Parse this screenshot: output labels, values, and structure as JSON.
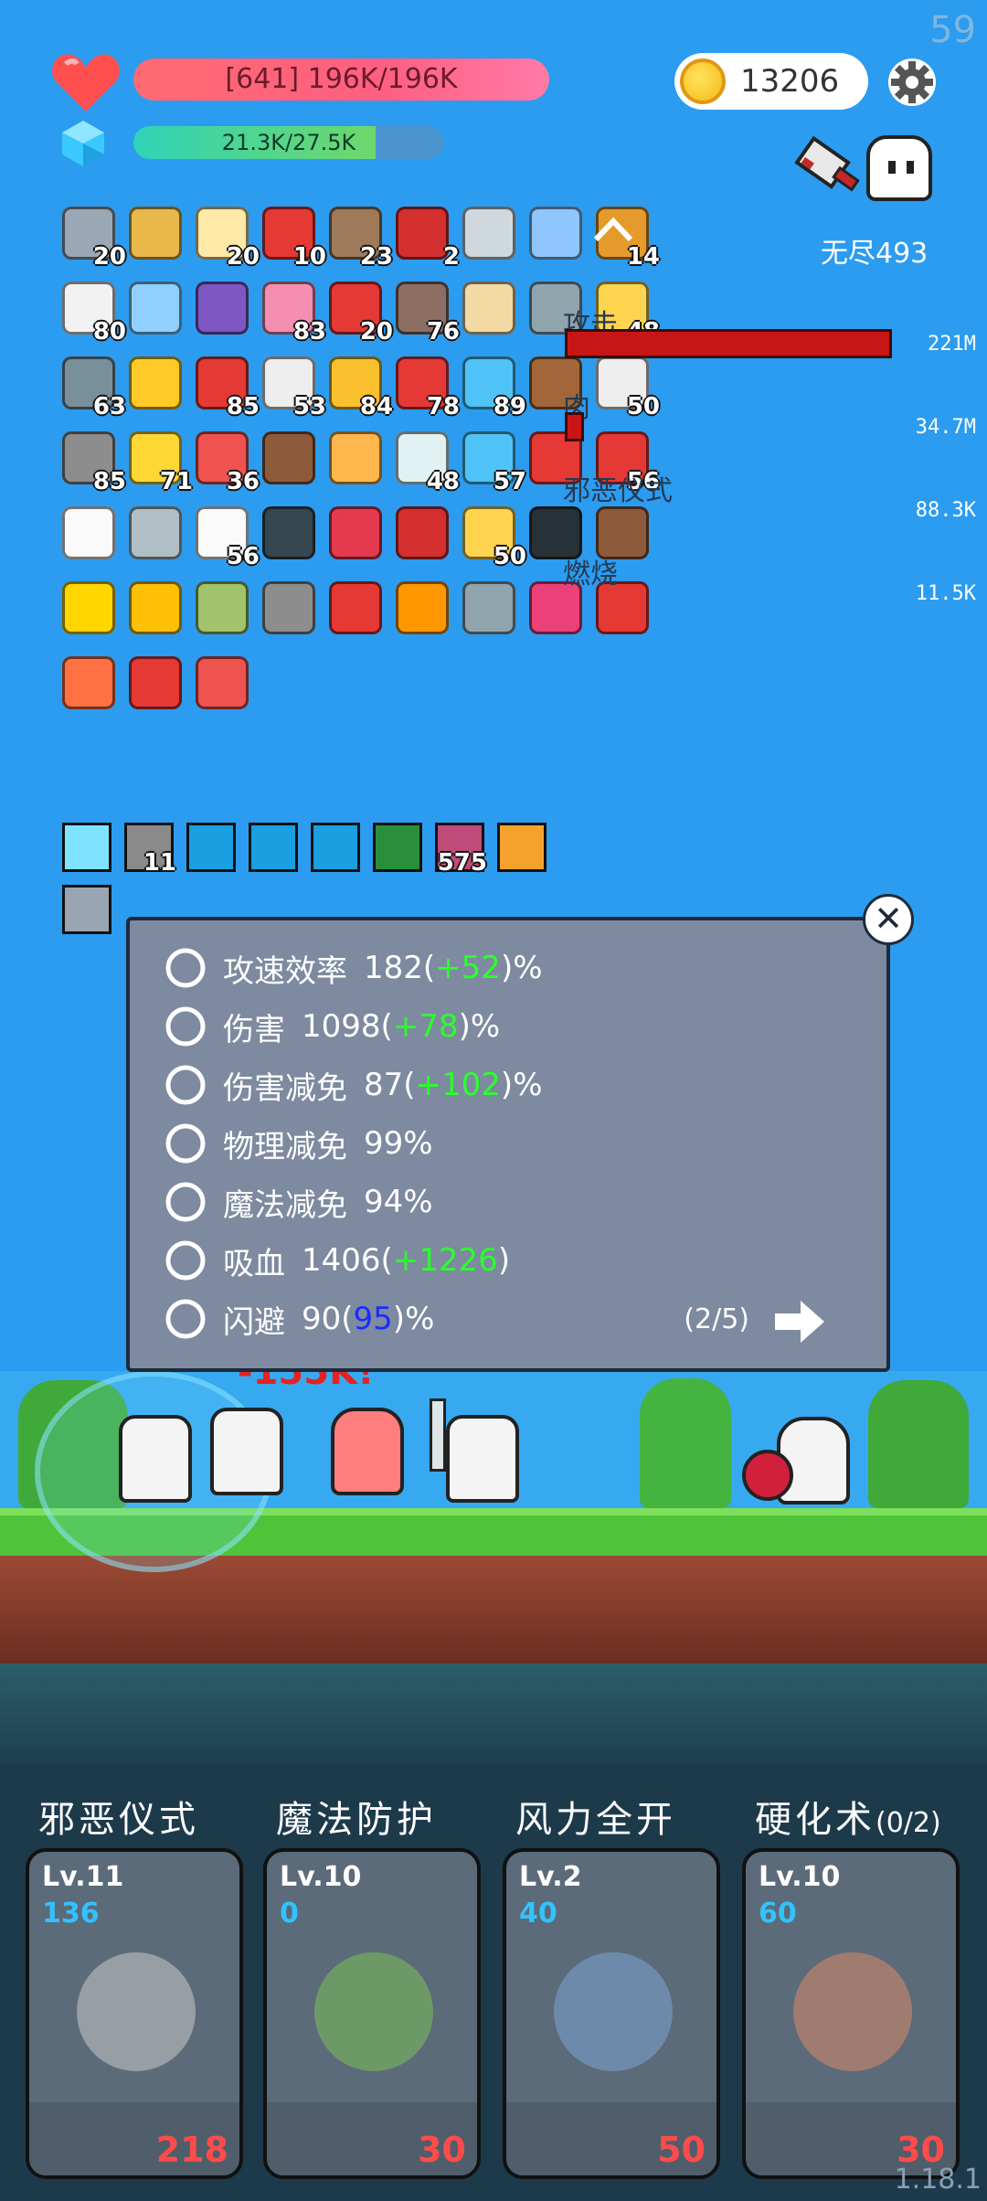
{
  "fps": "59",
  "hud": {
    "hp_text": "[641] 196K/196K",
    "mp_text": "21.3K/27.5K",
    "mp_fraction": 0.78,
    "coins": "13206",
    "mode": "无尽493"
  },
  "inventory": {
    "items": [
      {
        "icon": "sword-icon",
        "count": "20",
        "color": "#9aa7b4"
      },
      {
        "icon": "scroll-icon",
        "count": "",
        "color": "#e8b84a"
      },
      {
        "icon": "flower-icon",
        "count": "20",
        "color": "#ffe9a6"
      },
      {
        "icon": "apple-icon",
        "count": "10",
        "color": "#e53935"
      },
      {
        "icon": "target-icon",
        "count": "23",
        "color": "#9e7a5a"
      },
      {
        "icon": "magnet-icon",
        "count": "2",
        "color": "#d32f2f"
      },
      {
        "icon": "blade-icon",
        "count": "",
        "color": "#cfd8dc"
      },
      {
        "icon": "card-icon",
        "count": "",
        "color": "#8fc6ff"
      },
      {
        "icon": "book-icon",
        "count": "14",
        "color": "#e59b2b"
      },
      {
        "icon": "envelope-icon",
        "count": "80",
        "color": "#f2f2f2"
      },
      {
        "icon": "frame-icon",
        "count": "",
        "color": "#8fd0ff"
      },
      {
        "icon": "chest-icon",
        "count": "",
        "color": "#7e57c2"
      },
      {
        "icon": "icecream-icon",
        "count": "83",
        "color": "#f48fb1"
      },
      {
        "icon": "watermelon-icon",
        "count": "20",
        "color": "#e53935"
      },
      {
        "icon": "coconut-icon",
        "count": "76",
        "color": "#8d6e63"
      },
      {
        "icon": "map-icon",
        "count": "",
        "color": "#f3d9a4"
      },
      {
        "icon": "helmet-icon",
        "count": "",
        "color": "#90a4ae"
      },
      {
        "icon": "note-icon",
        "count": "48",
        "color": "#ffd54f"
      },
      {
        "icon": "mace-icon",
        "count": "63",
        "color": "#78909c"
      },
      {
        "icon": "ring-icon",
        "count": "",
        "color": "#ffca28"
      },
      {
        "icon": "redcard-icon",
        "count": "85",
        "color": "#e53935"
      },
      {
        "icon": "dice-icon",
        "count": "53",
        "color": "#eeeeee"
      },
      {
        "icon": "pineapple-icon",
        "count": "84",
        "color": "#fbc02d"
      },
      {
        "icon": "strawberry-icon",
        "count": "78",
        "color": "#e53935"
      },
      {
        "icon": "feather-icon",
        "count": "89",
        "color": "#4fc3f7"
      },
      {
        "icon": "drumstick-icon",
        "count": "",
        "color": "#a1663a"
      },
      {
        "icon": "cards-icon",
        "count": "50",
        "color": "#eeeeee"
      },
      {
        "icon": "tombstone-icon",
        "count": "85",
        "color": "#8d8d8d"
      },
      {
        "icon": "battery-icon",
        "count": "71",
        "color": "#fdd835"
      },
      {
        "icon": "pill-icon",
        "count": "36",
        "color": "#ef5350"
      },
      {
        "icon": "mushroom-icon",
        "count": "",
        "color": "#8d5a3a"
      },
      {
        "icon": "briefcase-icon",
        "count": "",
        "color": "#ffb74d"
      },
      {
        "icon": "bubbles-icon",
        "count": "48",
        "color": "#e0f2f1"
      },
      {
        "icon": "potion-icon",
        "count": "57",
        "color": "#4fc3f7"
      },
      {
        "icon": "hook-icon",
        "count": "",
        "color": "#e53935"
      },
      {
        "icon": "sock-icon",
        "count": "56",
        "color": "#e53935"
      },
      {
        "icon": "checklist-icon",
        "count": "",
        "color": "#fafafa"
      },
      {
        "icon": "hammer-icon",
        "count": "",
        "color": "#b0bec5"
      },
      {
        "icon": "ghost-icon",
        "count": "56",
        "color": "#fafafa"
      },
      {
        "icon": "skullbook-icon",
        "count": "",
        "color": "#37474f"
      },
      {
        "icon": "gem-icon",
        "count": "",
        "color": "#e53950"
      },
      {
        "icon": "shield-icon",
        "count": "",
        "color": "#d32f2f"
      },
      {
        "icon": "cheese-icon",
        "count": "50",
        "color": "#ffd54f"
      },
      {
        "icon": "cauldron-icon",
        "count": "",
        "color": "#263238"
      },
      {
        "icon": "drink-icon",
        "count": "",
        "color": "#8d5a3a"
      },
      {
        "icon": "sun-icon",
        "count": "",
        "color": "#ffd600"
      },
      {
        "icon": "wand-icon",
        "count": "",
        "color": "#ffc107"
      },
      {
        "icon": "crossbow-icon",
        "count": "",
        "color": "#a0c36b"
      },
      {
        "icon": "meteor-icon",
        "count": "",
        "color": "#8d8d8d"
      },
      {
        "icon": "shoe-icon",
        "count": "",
        "color": "#e53935"
      },
      {
        "icon": "crown-icon",
        "count": "",
        "color": "#ff9800"
      },
      {
        "icon": "axe-icon",
        "count": "",
        "color": "#90a4ae"
      },
      {
        "icon": "flame-icon",
        "count": "",
        "color": "#ec407a"
      },
      {
        "icon": "thermometer-icon",
        "count": "",
        "color": "#e53935"
      },
      {
        "icon": "gift-icon",
        "count": "",
        "color": "#ff7043"
      },
      {
        "icon": "heat-icon",
        "count": "",
        "color": "#e53935"
      },
      {
        "icon": "heart-icon",
        "count": "",
        "color": "#ef5350"
      }
    ]
  },
  "damage_stats": [
    {
      "label": "攻击",
      "value": "221M",
      "bar_fraction": 1.0
    },
    {
      "label": "肉",
      "value": "34.7M",
      "bar_fraction": 0.06
    },
    {
      "label": "邪恶仪式",
      "value": "88.3K",
      "bar_fraction": 0
    },
    {
      "label": "燃烧",
      "value": "11.5K",
      "bar_fraction": 0
    }
  ],
  "buffs": [
    {
      "icon": "light-buff-icon",
      "count": "",
      "color": "#7fe3ff"
    },
    {
      "icon": "armor-buff-icon",
      "count": "11",
      "color": "#8a8a8a"
    },
    {
      "icon": "vortex-buff-icon",
      "count": "",
      "color": "#1a9fe0"
    },
    {
      "icon": "vortex-buff-icon",
      "count": "",
      "color": "#1a9fe0"
    },
    {
      "icon": "vortex-buff-icon",
      "count": "",
      "color": "#1a9fe0"
    },
    {
      "icon": "wind-buff-icon",
      "count": "",
      "color": "#2a8f3a"
    },
    {
      "icon": "ritual-buff-icon",
      "count": "575",
      "color": "#c04a7a"
    },
    {
      "icon": "fire-buff-icon",
      "count": "",
      "color": "#f3a32b"
    },
    {
      "icon": "shadow-buff-icon",
      "count": "",
      "color": "#9aa5b3"
    }
  ],
  "popup": {
    "rows": [
      {
        "icon": "bullets-icon",
        "label": "攻速效率",
        "value": "182",
        "bonus": "+52",
        "suffix": "%"
      },
      {
        "icon": "crossed-axes-icon",
        "label": "伤害",
        "value": "1098",
        "bonus": "+78",
        "suffix": "%"
      },
      {
        "icon": "target-icon",
        "label": "伤害减免",
        "value": "87",
        "bonus": "+102",
        "suffix": "%"
      },
      {
        "icon": "shield-icon",
        "label": "物理减免",
        "value": "99%",
        "bonus": "",
        "suffix": ""
      },
      {
        "icon": "magic-shield-icon",
        "label": "魔法减免",
        "value": "94%",
        "bonus": "",
        "suffix": ""
      },
      {
        "icon": "horned-skull-icon",
        "label": "吸血",
        "value": "1406",
        "bonus": "+1226",
        "suffix": ""
      },
      {
        "icon": "lines-icon",
        "label": "闪避",
        "value": "90",
        "bonus": "95",
        "suffix": "%"
      }
    ],
    "pager": "(2/5)"
  },
  "battle": {
    "damage_popup": "-155K!"
  },
  "skills": [
    {
      "name": "邪恶仪式",
      "extra": "",
      "level": "Lv.11",
      "mana": "136",
      "cost": "218",
      "art": "eye-icon"
    },
    {
      "name": "魔法防护",
      "extra": "",
      "level": "Lv.10",
      "mana": "0",
      "cost": "30",
      "art": "leaves-icon"
    },
    {
      "name": "风力全开",
      "extra": "",
      "level": "Lv.2",
      "mana": "40",
      "cost": "50",
      "art": "feather-icon"
    },
    {
      "name": "硬化术",
      "extra": "(0/2)",
      "level": "Lv.10",
      "mana": "60",
      "cost": "30",
      "art": "vase-icon"
    }
  ],
  "version": "1.18.1"
}
